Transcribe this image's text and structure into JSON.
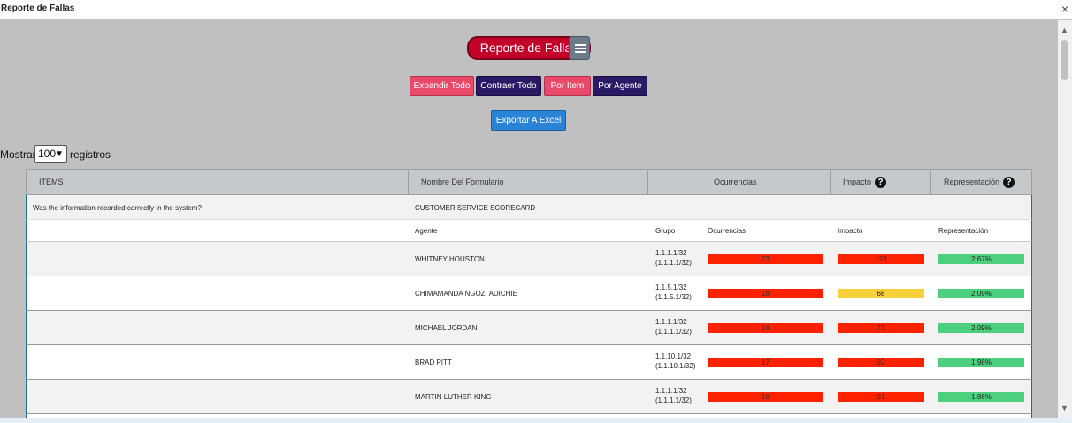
{
  "window": {
    "title": "Reporte de Fallas",
    "close": "×"
  },
  "header": {
    "main_button": "Reporte de Fallas",
    "list_icon": "list-icon"
  },
  "actions": {
    "expand": "Expandir Todo",
    "collapse": "Contraer Todo",
    "by_item": "Por Item",
    "by_agent": "Por Agente",
    "export": "Exportar A Excel"
  },
  "length": {
    "show": "Mostrar",
    "value": "100",
    "records": "registros"
  },
  "columns": {
    "items": "ITEMS",
    "form": "Nombre Del Formulario",
    "occurrences": "Ocurrencias",
    "impact": "Impacto",
    "representation": "Representación",
    "help": "?"
  },
  "group": {
    "question": "Was the information recorded correctly in the system?",
    "form": "CUSTOMER SERVICE SCORECARD"
  },
  "subheader": {
    "agent": "Agente",
    "group": "Grupo",
    "occurrences": "Ocurrencias",
    "impact": "Impacto",
    "representation": "Representación"
  },
  "rows": [
    {
      "agent": "WHITNEY HOUSTON",
      "group1": "1.1.1.1/32",
      "group2": "(1.1.1.1/32)",
      "occurrences": "23",
      "impact": "123",
      "representation": "2.67%",
      "impact_color": "#ff2200"
    },
    {
      "agent": "CHIMAMANDA NGOZI ADICHIE",
      "group1": "1.1.5.1/32",
      "group2": "(1.1.5.1/32)",
      "occurrences": "18",
      "impact": "68",
      "representation": "2.09%",
      "impact_color": "#f7d03c"
    },
    {
      "agent": "MICHAEL JORDAN",
      "group1": "1.1.1.1/32",
      "group2": "(1.1.1.1/32)",
      "occurrences": "18",
      "impact": "73",
      "representation": "2.09%",
      "impact_color": "#ff2200"
    },
    {
      "agent": "BRAD PITT",
      "group1": "1.1.10.1/32",
      "group2": "(1.1.10.1/32)",
      "occurrences": "17",
      "impact": "92",
      "representation": "1.98%",
      "impact_color": "#ff2200"
    },
    {
      "agent": "MARTIN LUTHER KING",
      "group1": "1.1.1.1/32",
      "group2": "(1.1.1.1/32)",
      "occurrences": "16",
      "impact": "91",
      "representation": "1.86%",
      "impact_color": "#ff2200"
    }
  ]
}
